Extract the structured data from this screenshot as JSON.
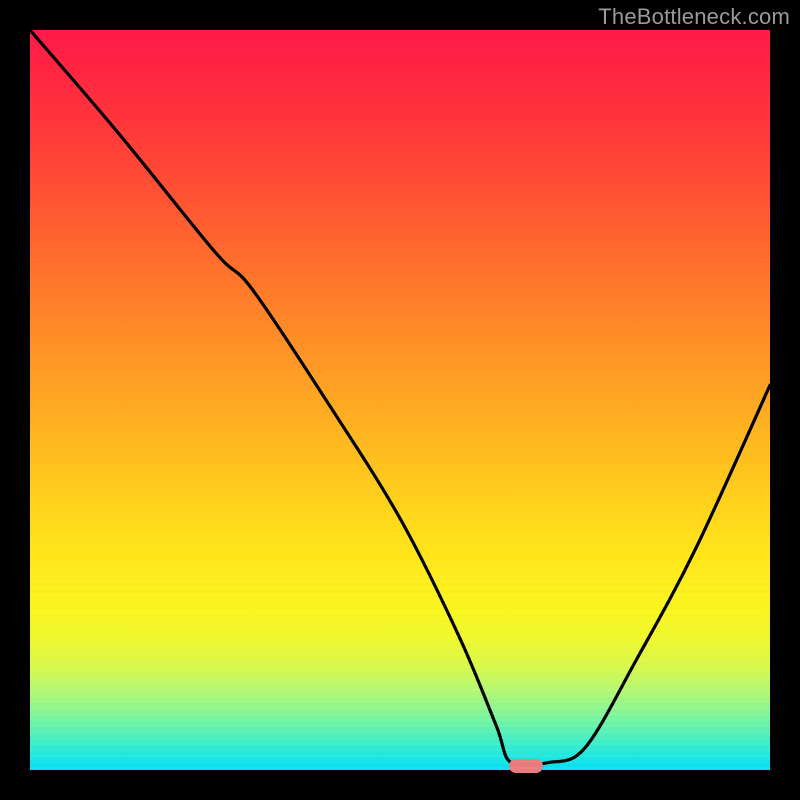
{
  "watermark": "TheBottleneck.com",
  "colors": {
    "background": "#000000",
    "curve": "#000000",
    "marker": "#e97b7d",
    "watermark": "#9a9a9a"
  },
  "chart_data": {
    "type": "line",
    "title": "",
    "xlabel": "",
    "ylabel": "",
    "xlim": [
      0,
      100
    ],
    "ylim": [
      0,
      100
    ],
    "grid": false,
    "legend": false,
    "background_gradient": [
      "#ff1a47",
      "#ffd21c",
      "#05e0f2"
    ],
    "series": [
      {
        "name": "bottleneck-curve",
        "x": [
          0,
          12,
          25,
          30,
          40,
          50,
          58,
          63,
          65,
          70,
          75,
          82,
          90,
          100
        ],
        "values": [
          100,
          86,
          70,
          65,
          50,
          34,
          18,
          6,
          1,
          1,
          3,
          15,
          30,
          52
        ]
      }
    ],
    "marker": {
      "x": 67,
      "y": 0.5,
      "shape": "pill",
      "color": "#e97b7d"
    }
  }
}
